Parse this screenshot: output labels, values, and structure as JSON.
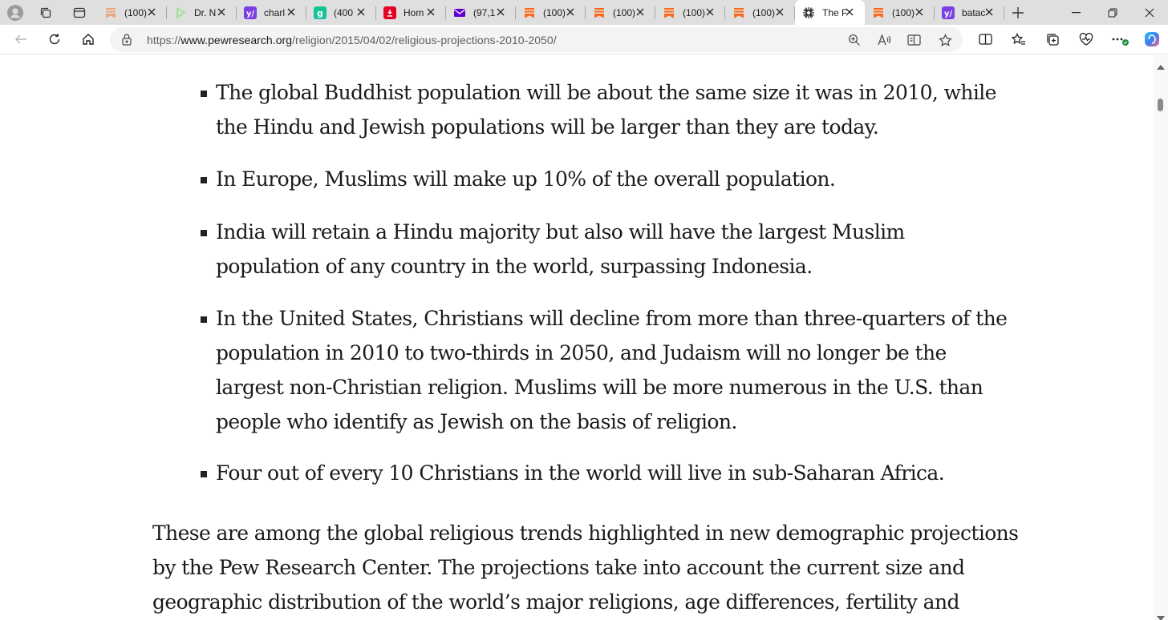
{
  "tabs": [
    {
      "title": "(100)",
      "icon": "substack-icon",
      "color": "#e8a87c"
    },
    {
      "title": "Dr. N",
      "icon": "play-icon",
      "color": "#9be38f"
    },
    {
      "title": "charl",
      "icon": "yahoo-icon",
      "color": "#7b3fe4"
    },
    {
      "title": "(400",
      "icon": "grammarly-icon",
      "color": "#15c39a"
    },
    {
      "title": "Hom",
      "icon": "pinterest-icon",
      "color": "#e60023"
    },
    {
      "title": "(97,1",
      "icon": "mail-icon",
      "color": "#6001d2"
    },
    {
      "title": "(100)",
      "icon": "substack-icon",
      "color": "#ff6719"
    },
    {
      "title": "(100)",
      "icon": "substack-icon",
      "color": "#ff6719"
    },
    {
      "title": "(100)",
      "icon": "substack-icon",
      "color": "#ff6719"
    },
    {
      "title": "(100)",
      "icon": "substack-icon",
      "color": "#ff6719"
    },
    {
      "title": "The P",
      "icon": "pew-icon",
      "color": "#222222",
      "active": true
    },
    {
      "title": "(100)",
      "icon": "substack-icon",
      "color": "#ff6719"
    },
    {
      "title": "batac",
      "icon": "yahoo-icon",
      "color": "#7b3fe4"
    }
  ],
  "address": {
    "scheme": "https://",
    "host": "www.pewresearch.org",
    "path": "/religion/2015/04/02/religious-projections-2010-2050/"
  },
  "article": {
    "bullets": [
      {
        "lines": [
          "The global Buddhist population will be about the same size it was in 2010, while",
          "the Hindu and Jewish populations will be larger than they are today."
        ]
      },
      {
        "lines": [
          "In Europe, Muslims will make up 10% of the overall population."
        ]
      },
      {
        "lines": [
          "India will retain a Hindu majority but also will have the largest Muslim",
          "population of any country in the world, surpassing Indonesia."
        ]
      },
      {
        "lines": [
          "In the United States, Christians will decline from more than three-quarters of the",
          "population in 2010 to two-thirds in 2050, and Judaism will no longer be the",
          "largest non-Christian religion. Muslims will be more numerous in the U.S. than",
          "people who identify as Jewish on the basis of religion."
        ]
      },
      {
        "lines": [
          "Four out of every 10 Christians in the world will live in sub-Saharan Africa."
        ]
      }
    ],
    "paragraph_lines": [
      "These are among the global religious trends highlighted in new demographic projections",
      "by the Pew Research Center. The projections take into account the current size and",
      "geographic distribution of the world’s major religions, age differences, fertility and"
    ]
  }
}
